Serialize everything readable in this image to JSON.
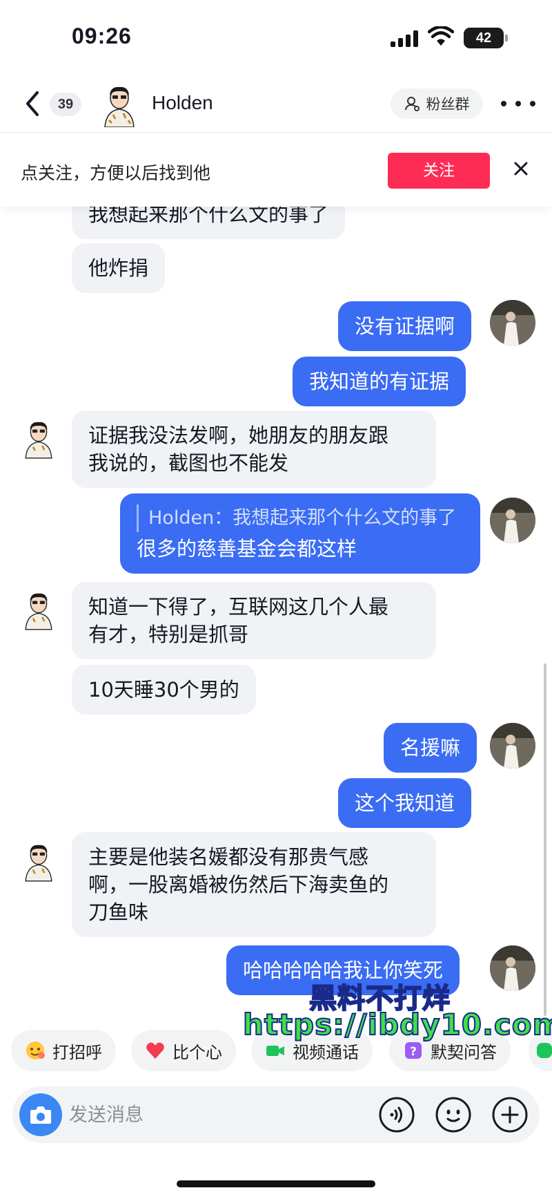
{
  "status": {
    "time": "09:26",
    "battery": "42"
  },
  "header": {
    "unread_count": "39",
    "contact_name": "Holden",
    "fans_group_label": "粉丝群"
  },
  "follow_banner": {
    "text": "点关注，方便以后找到他",
    "follow_label": "关注"
  },
  "messages": [
    {
      "side": "in",
      "text": "我想起来那个什么文的事了"
    },
    {
      "side": "in",
      "text": "他炸捐"
    },
    {
      "side": "out",
      "text": "没有证据啊"
    },
    {
      "side": "out",
      "text": "我知道的有证据"
    },
    {
      "side": "in",
      "lines": [
        "证据我没法发啊，她朋友的朋友跟",
        "我说的，截图也不能发"
      ]
    },
    {
      "side": "out",
      "quote": "Holden：我想起来那个什么文的事了",
      "text": "很多的慈善基金会都这样"
    },
    {
      "side": "in",
      "lines": [
        "知道一下得了，互联网这几个人最",
        "有才，特别是抓哥"
      ]
    },
    {
      "side": "in",
      "text": "10天睡30个男的"
    },
    {
      "side": "out",
      "text": "名援嘛"
    },
    {
      "side": "out",
      "text": "这个我知道"
    },
    {
      "side": "in",
      "lines": [
        "主要是他装名媛都没有那贵气感",
        "啊，一股离婚被伤然后下海卖鱼的",
        "刀鱼味"
      ]
    },
    {
      "side": "out",
      "text": "哈哈哈哈哈我让你笑死"
    }
  ],
  "watermark": {
    "line1": "黑料不打烊",
    "line2": "https://ibdy10.com"
  },
  "quick_replies": [
    {
      "label": "打招呼",
      "icon": "wave-emoji-icon"
    },
    {
      "label": "比个心",
      "icon": "heart-icon"
    },
    {
      "label": "视频通话",
      "icon": "video-call-icon"
    },
    {
      "label": "默契问答",
      "icon": "quiz-icon"
    }
  ],
  "input": {
    "placeholder": "发送消息"
  },
  "colors": {
    "accent_blue": "#3a6cf4",
    "follow_red": "#fe2c55",
    "bubble_gray": "#f1f2f5",
    "watermark_green": "#3ee04a"
  }
}
